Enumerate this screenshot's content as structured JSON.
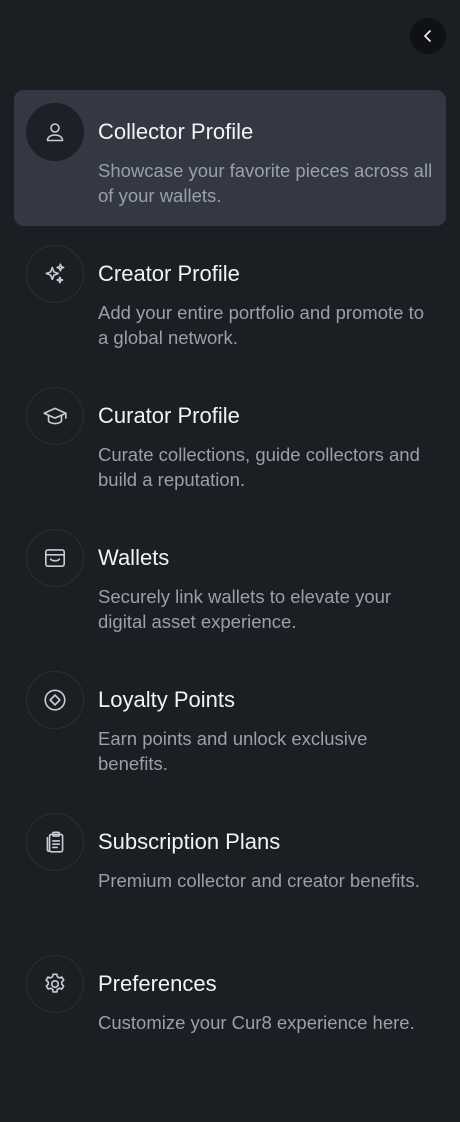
{
  "menu": {
    "items": [
      {
        "title": "Collector Profile",
        "description": "Showcase your favorite pieces across all of your wallets.",
        "icon": "user-icon",
        "active": true
      },
      {
        "title": "Creator Profile",
        "description": "Add your entire portfolio and promote to a global network.",
        "icon": "sparkles-icon",
        "active": false
      },
      {
        "title": "Curator Profile",
        "description": "Curate collections, guide collectors and build a reputation.",
        "icon": "graduation-cap-icon",
        "active": false
      },
      {
        "title": "Wallets",
        "description": "Securely link wallets to elevate your digital asset experience.",
        "icon": "wallet-icon",
        "active": false
      },
      {
        "title": "Loyalty Points",
        "description": "Earn points and unlock exclusive benefits.",
        "icon": "diamond-coin-icon",
        "active": false
      },
      {
        "title": "Subscription Plans",
        "description": "Premium collector and creator benefits.",
        "icon": "clipboard-icon",
        "active": false
      },
      {
        "title": "Preferences",
        "description": "Customize your Cur8 experience here.",
        "icon": "gear-icon",
        "active": false
      }
    ]
  },
  "colors": {
    "background": "#1b1e23",
    "active_item": "#333842",
    "title": "#f2f3f5",
    "description": "#9aa0aa"
  }
}
